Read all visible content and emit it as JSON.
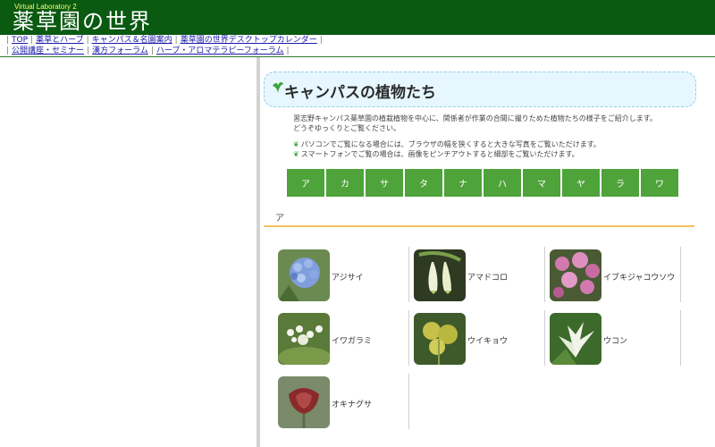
{
  "header": {
    "small_title": "Virtual Laboratory 2",
    "title": "薬草園の世界"
  },
  "nav": {
    "row1": [
      "TOP",
      "薬草とハーブ",
      "キャンパス＆名園案内",
      "薬草園の世界デスクトップカレンダー"
    ],
    "row2": [
      "公開講座・セミナー",
      "漢方フォーラム",
      "ハーブ・アロマテラピーフォーラム"
    ]
  },
  "banner": {
    "title": "キャンパスの植物たち"
  },
  "intro": {
    "line1": "習志野キャンパス薬草園の植栽植物を中心に、関係者が作業の合間に撮りためた植物たちの様子をご紹介します。",
    "line2": "どうぞゆっくりとご覧ください。"
  },
  "notes": {
    "line1": "パソコンでご覧になる場合には、ブラウザの幅を狭くすると大きな写真をご覧いただけます。",
    "line2": "スマートフォンでご覧の場合は、画像をピンチアウトすると細部をご覧いただけます。"
  },
  "kana_index": [
    "ア",
    "カ",
    "サ",
    "タ",
    "ナ",
    "ハ",
    "マ",
    "ヤ",
    "ラ",
    "ワ"
  ],
  "section": {
    "heading": "ア"
  },
  "plants": [
    {
      "name": "アジサイ"
    },
    {
      "name": "アマドコロ"
    },
    {
      "name": "イブキジャコウソウ"
    },
    {
      "name": "イワガラミ"
    },
    {
      "name": "ウイキョウ"
    },
    {
      "name": "ウコン"
    },
    {
      "name": "オキナグサ"
    }
  ],
  "colors": {
    "header_bg": "#0a5a12",
    "kana_button": "#4ea33a",
    "section_line": "#f5c067",
    "banner_bg": "#e6f7ff"
  }
}
